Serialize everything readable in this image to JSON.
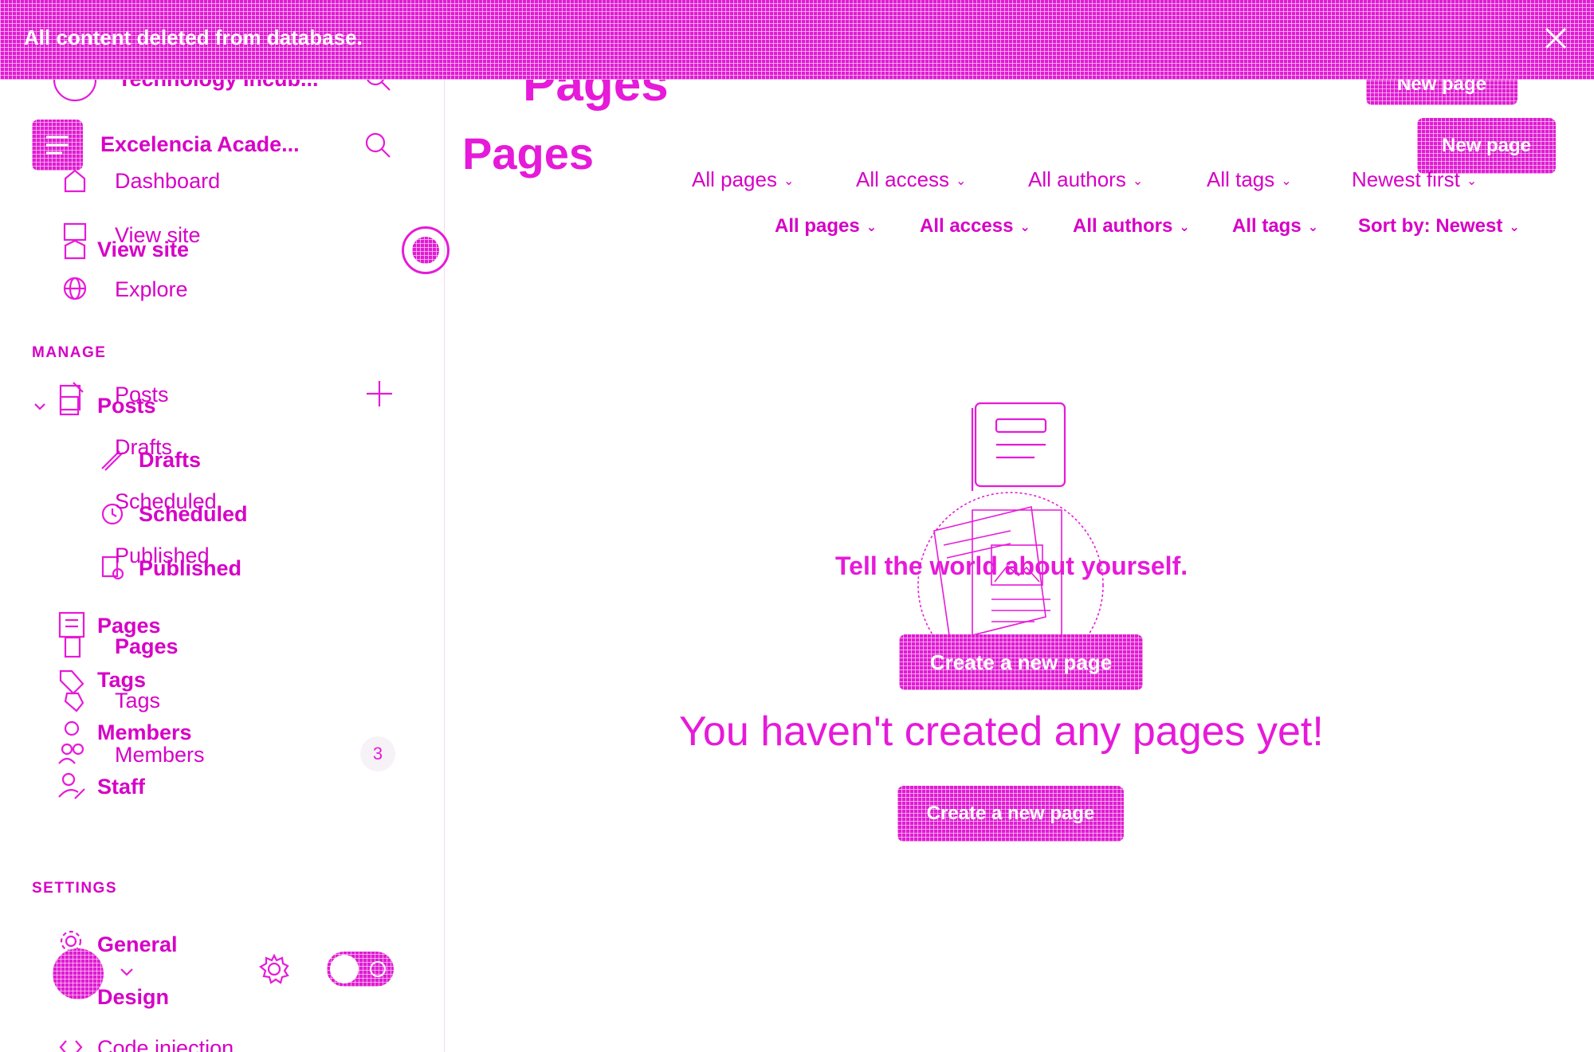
{
  "banner": {
    "message": "All content deleted from database.",
    "close_icon": "close-icon"
  },
  "sidebar": {
    "ghost_site_title": "Technology Incub...",
    "site_title": "Excelencia Acade...",
    "nav": {
      "dashboard": "Dashboard",
      "view_site": "View site",
      "view_site_dup": "View site",
      "explore": "Explore"
    },
    "manage_label": "MANAGE",
    "manage": {
      "posts": "Posts",
      "posts_dup": "Posts",
      "drafts": "Drafts",
      "drafts_dup": "Drafts",
      "scheduled": "Scheduled",
      "scheduled_dup": "Scheduled",
      "published": "Published",
      "published_dup": "Published",
      "pages": "Pages",
      "pages_dup": "Pages",
      "tags": "Tags",
      "tags_dup": "Tags",
      "members": "Members",
      "members_dup": "Members",
      "members_count": "3",
      "staff": "Staff"
    },
    "settings_label": "SETTINGS",
    "settings": {
      "general": "General",
      "design": "Design",
      "code_injection": "Code injection"
    }
  },
  "main": {
    "ghost_title": "Pages",
    "title": "Pages",
    "ghost_new_page_button": "New page",
    "new_page_button": "New page",
    "filters_ghost": [
      "All pages",
      "All access",
      "All authors",
      "All tags",
      "Newest first"
    ],
    "filters": [
      "All pages",
      "All access",
      "All authors",
      "All tags",
      "Sort by: Newest"
    ],
    "empty_tagline": "Tell the world about yourself.",
    "empty_button_ghost": "Create a new page",
    "empty_heading": "You haven't created any pages yet!",
    "empty_button": "Create a new page"
  },
  "colors": {
    "accent": "#e61ad9",
    "background": "#ffffff"
  }
}
